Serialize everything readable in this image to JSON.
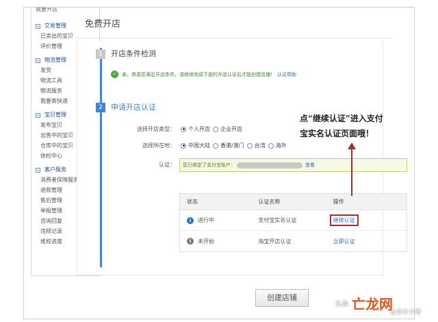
{
  "sidebar": {
    "top_cut": "我要开店",
    "sections": [
      {
        "title": "交易管理",
        "items": [
          "已卖出的宝贝",
          "评价管理"
        ]
      },
      {
        "title": "物流管理",
        "items": [
          "发货",
          "物流工具",
          "物流服务",
          "我要寄快递"
        ]
      },
      {
        "title": "宝贝管理",
        "items": [
          "发布宝贝",
          "出售中的宝贝",
          "仓库中的宝贝",
          "体检中心"
        ]
      },
      {
        "title": "客户服务",
        "items": [
          "消费者保障服务",
          "退款管理",
          "售后管理",
          "举报管理",
          "咨询回复",
          "违规记录",
          "维权进度"
        ]
      }
    ]
  },
  "main": {
    "title": "免费开店",
    "step1": {
      "num": "1",
      "title": "开店条件检测",
      "check_text": "亲，恭喜您满足开店条件，请继续完成下面的开店认证后才能创建店铺！",
      "check_link": "认证帮助"
    },
    "step2": {
      "num": "2",
      "title": "申请开店认证"
    },
    "form": {
      "type_label": "选择开店类型：",
      "type_opt1": "个人开店",
      "type_opt2": "企业开店",
      "region_label": "选择所在地：",
      "region_opt1": "中国大陆",
      "region_opt2": "香港/澳门",
      "region_opt3": "台湾",
      "region_opt4": "海外",
      "cert_label": "认证：",
      "cert_text": "您已绑定了支付宝账户：",
      "cert_link": "查看"
    },
    "table": {
      "headers": [
        "状态",
        "认证名称",
        "操作"
      ],
      "rows": [
        {
          "status": "进行中",
          "name": "支付宝实名认证",
          "action": "继续认证"
        },
        {
          "status": "未开始",
          "name": "淘宝开店认证",
          "action": "立即认证"
        }
      ]
    },
    "create_button": "创建店铺"
  },
  "annotation": {
    "line1": "点“继续认证”进入支付",
    "line2": "宝实名认证页面哦！"
  },
  "watermark": {
    "prefix": "头条",
    "logo": "亡龙网",
    "sub": "@会计小港"
  },
  "colors": {
    "accent": "#3f86d0",
    "highlight": "#b02a2a",
    "success": "#4aa83a"
  }
}
